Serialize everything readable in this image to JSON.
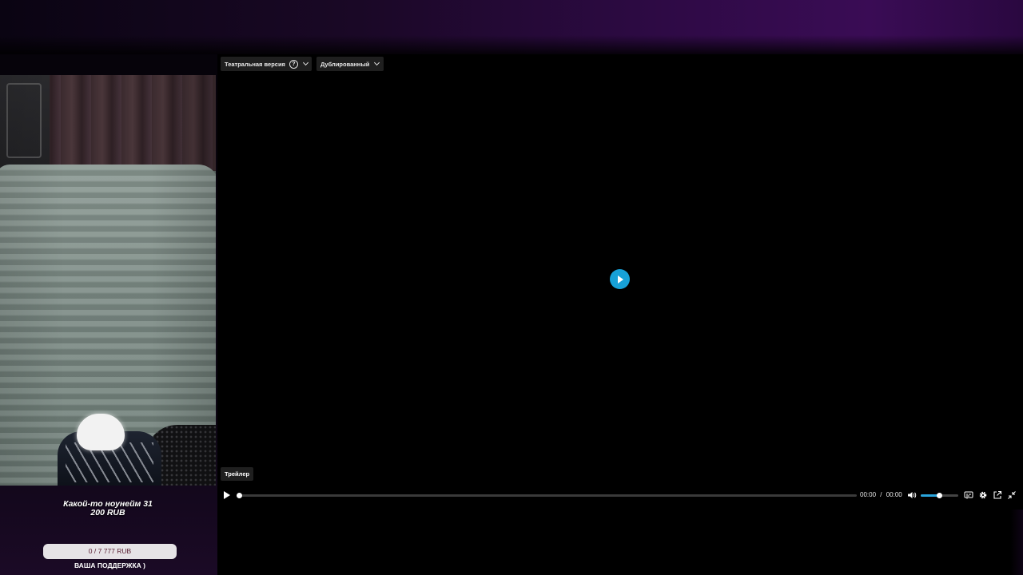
{
  "player": {
    "version_selector": {
      "label": "Театральная версия"
    },
    "audio_selector": {
      "label": "Дублированный"
    },
    "trailer_label": "Трейлер",
    "time": {
      "current": "00:00",
      "separator": "/",
      "total": "00:00"
    },
    "progress": 0,
    "volume": 0.5,
    "accent_color": "#17a1d8"
  },
  "stream_overlay": {
    "donor_line1": "Какой-то ноунейм 31",
    "donor_line2": "200 RUB",
    "goal_progress": "0 / 7 777 RUB",
    "goal_label": "ВАША ПОДДЕРЖКА )"
  },
  "icons": [
    "help-icon",
    "chevron-down-icon",
    "play-icon",
    "volume-icon",
    "subtitles-icon",
    "settings-gear-icon",
    "popout-icon",
    "exit-fullscreen-icon"
  ]
}
